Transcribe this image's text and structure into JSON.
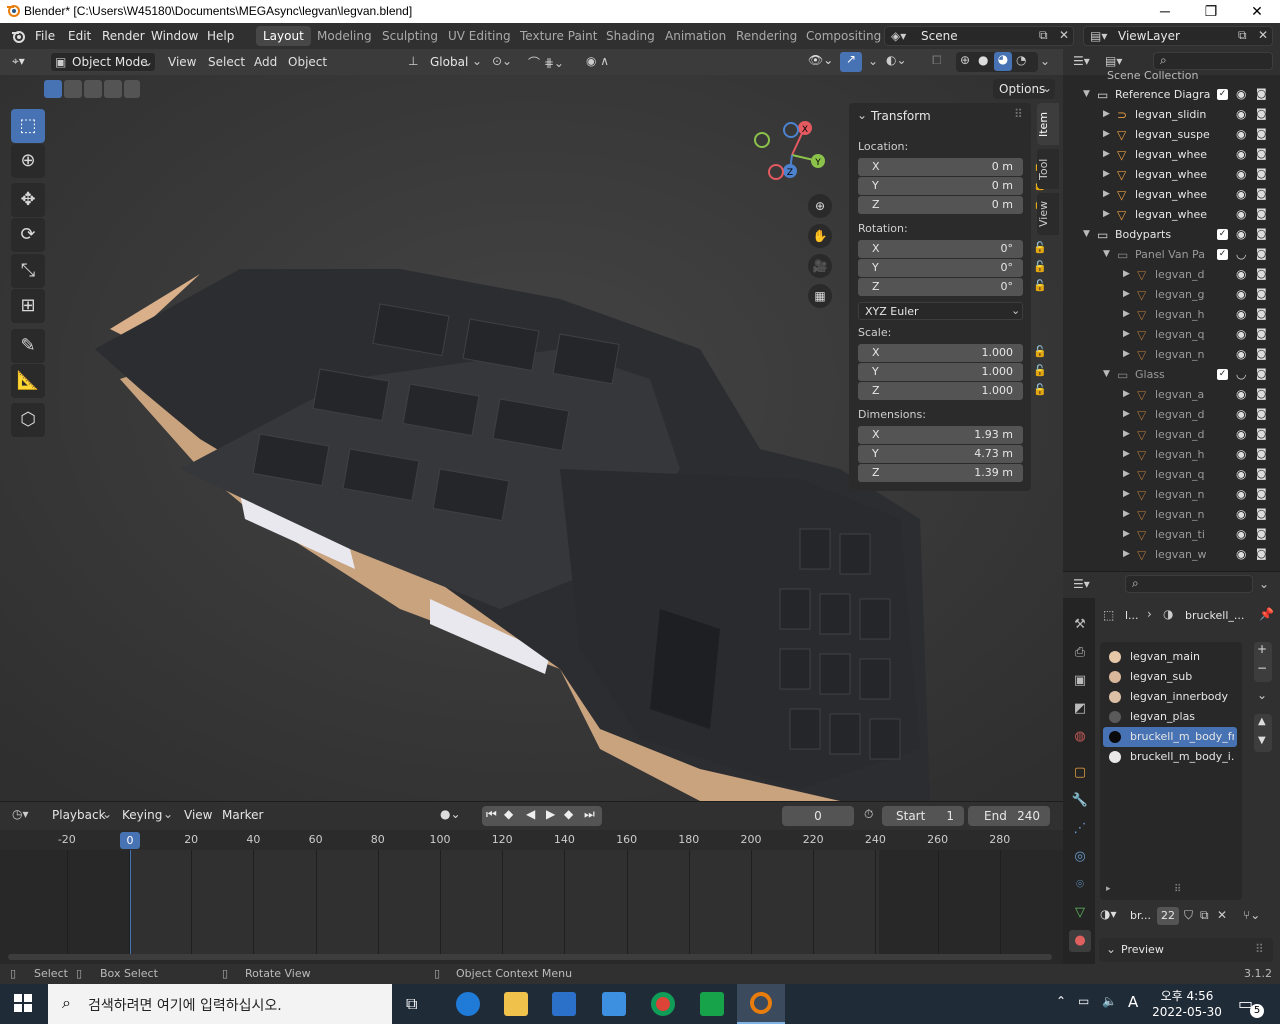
{
  "window": {
    "title": "Blender* [C:\\Users\\W45180\\Documents\\MEGAsync\\legvan\\legvan.blend]"
  },
  "menu": [
    "File",
    "Edit",
    "Render",
    "Window",
    "Help"
  ],
  "workspaces": [
    "Layout",
    "Modeling",
    "Sculpting",
    "UV Editing",
    "Texture Paint",
    "Shading",
    "Animation",
    "Rendering",
    "Compositing"
  ],
  "scene": {
    "name": "Scene",
    "view_layer": "ViewLayer"
  },
  "viewport": {
    "mode": "Object Mode",
    "menus": [
      "View",
      "Select",
      "Add",
      "Object"
    ],
    "orientation": "Global",
    "options_label": "Options"
  },
  "transform": {
    "title": "Transform",
    "location_label": "Location:",
    "location": [
      {
        "axis": "X",
        "value": "0 m"
      },
      {
        "axis": "Y",
        "value": "0 m"
      },
      {
        "axis": "Z",
        "value": "0 m"
      }
    ],
    "rotation_label": "Rotation:",
    "rotation": [
      {
        "axis": "X",
        "value": "0°"
      },
      {
        "axis": "Y",
        "value": "0°"
      },
      {
        "axis": "Z",
        "value": "0°"
      }
    ],
    "rotation_mode": "XYZ Euler",
    "scale_label": "Scale:",
    "scale": [
      {
        "axis": "X",
        "value": "1.000"
      },
      {
        "axis": "Y",
        "value": "1.000"
      },
      {
        "axis": "Z",
        "value": "1.000"
      }
    ],
    "dimensions_label": "Dimensions:",
    "dimensions": [
      {
        "axis": "X",
        "value": "1.93 m"
      },
      {
        "axis": "Y",
        "value": "4.73 m"
      },
      {
        "axis": "Z",
        "value": "1.39 m"
      }
    ]
  },
  "side_tabs": [
    "Item",
    "Tool",
    "View"
  ],
  "gizmo": {
    "x": "X",
    "y": "Y",
    "z": "Z"
  },
  "outliner": {
    "header": "Scene Collection",
    "rows": [
      {
        "name": "Reference Diagra",
        "type": "collection"
      },
      {
        "name": "legvan_slidin",
        "type": "curve"
      },
      {
        "name": "legvan_suspe",
        "type": "mesh"
      },
      {
        "name": "legvan_whee",
        "type": "mesh"
      },
      {
        "name": "legvan_whee",
        "type": "mesh"
      },
      {
        "name": "legvan_whee",
        "type": "mesh"
      },
      {
        "name": "legvan_whee",
        "type": "mesh"
      },
      {
        "name": "Bodyparts",
        "type": "collection"
      },
      {
        "name": "Panel Van Pa",
        "type": "collection-dim"
      },
      {
        "name": "legvan_d",
        "type": "mesh-dim"
      },
      {
        "name": "legvan_g",
        "type": "mesh-dim"
      },
      {
        "name": "legvan_h",
        "type": "mesh-dim"
      },
      {
        "name": "legvan_q",
        "type": "mesh-dim"
      },
      {
        "name": "legvan_n",
        "type": "mesh-dim"
      },
      {
        "name": "Glass",
        "type": "collection-dim"
      },
      {
        "name": "legvan_a",
        "type": "mesh-dim"
      },
      {
        "name": "legvan_d",
        "type": "mesh-dim"
      },
      {
        "name": "legvan_d",
        "type": "mesh-dim"
      },
      {
        "name": "legvan_h",
        "type": "mesh-dim"
      },
      {
        "name": "legvan_q",
        "type": "mesh-dim"
      },
      {
        "name": "legvan_n",
        "type": "mesh-dim"
      },
      {
        "name": "legvan_n",
        "type": "mesh-dim"
      },
      {
        "name": "legvan_ti",
        "type": "mesh-dim"
      },
      {
        "name": "legvan_w",
        "type": "mesh-dim"
      }
    ]
  },
  "properties": {
    "breadcrumb_object": "l...",
    "breadcrumb_material": "bruckell_...",
    "materials": [
      {
        "name": "legvan_main",
        "color": "#e6c7a8"
      },
      {
        "name": "legvan_sub",
        "color": "#d8b79a"
      },
      {
        "name": "legvan_innerbody",
        "color": "#dcc0a6"
      },
      {
        "name": "legvan_plas",
        "color": "#5a5a5a"
      },
      {
        "name": "bruckell_m_body_fr...",
        "color": "#0a0a0a"
      },
      {
        "name": "bruckell_m_body_i...",
        "color": "#e8e8e8"
      }
    ],
    "material_slot_name": "br...",
    "users": "22",
    "preview_label": "Preview"
  },
  "timeline": {
    "menus": [
      "Playback",
      "Keying",
      "View",
      "Marker"
    ],
    "current_frame": "0",
    "start_label": "Start",
    "start": "1",
    "end_label": "End",
    "end": "240",
    "ticks": [
      "-20",
      "0",
      "20",
      "40",
      "60",
      "80",
      "100",
      "120",
      "140",
      "160",
      "180",
      "200",
      "220",
      "240",
      "260",
      "280"
    ]
  },
  "status": {
    "select": "Select",
    "box_select": "Box Select",
    "rotate_view": "Rotate View",
    "context_menu": "Object Context Menu",
    "version": "3.1.2"
  },
  "taskbar": {
    "search_placeholder": "검색하려면 여기에 입력하십시오.",
    "time": "오후 4:56",
    "date": "2022-05-30",
    "ime": "A",
    "notifications": "5"
  },
  "colors": {
    "accent": "#4772b3",
    "selected_frame": "#4772b3",
    "panel": "#2b2b2b"
  }
}
